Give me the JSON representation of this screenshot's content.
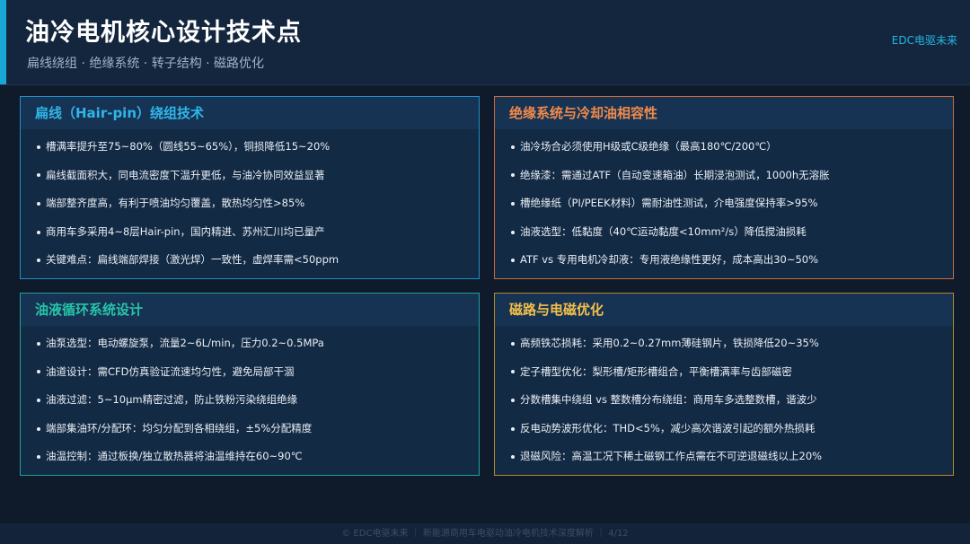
{
  "header": {
    "title": "油冷电机核心设计技术点",
    "subtitle": "扁线绕组 · 绝缘系统 · 转子结构 · 磁路优化",
    "brand": "EDC电驱未来"
  },
  "cards": [
    {
      "title": "扁线（Hair-pin）绕组技术",
      "items": [
        "槽满率提升至75~80%（圆线55~65%），铜损降低15~20%",
        "扁线截面积大，同电流密度下温升更低，与油冷协同效益显著",
        "端部整齐度高，有利于喷油均匀覆盖，散热均匀性>85%",
        "商用车多采用4~8层Hair-pin，国内精进、苏州汇川均已量产",
        "关键难点：扁线端部焊接（激光焊）一致性，虚焊率需<50ppm"
      ]
    },
    {
      "title": "绝缘系统与冷却油相容性",
      "items": [
        "油冷场合必须使用H级或C级绝缘（最高180℃/200℃）",
        "绝缘漆：需通过ATF（自动变速箱油）长期浸泡测试，1000h无溶胀",
        "槽绝缘纸（PI/PEEK材料）需耐油性测试，介电强度保持率>95%",
        "油液选型：低黏度（40℃运动黏度<10mm²/s）降低搅油损耗",
        "ATF vs 专用电机冷却液：专用液绝缘性更好，成本高出30~50%"
      ]
    },
    {
      "title": "油液循环系统设计",
      "items": [
        "油泵选型：电动螺旋泵，流量2~6L/min，压力0.2~0.5MPa",
        "油道设计：需CFD仿真验证流速均匀性，避免局部干涸",
        "油液过滤：5~10μm精密过滤，防止铁粉污染绕组绝缘",
        "端部集油环/分配环：均匀分配到各相绕组，±5%分配精度",
        "油温控制：通过板换/独立散热器将油温维持在60~90℃"
      ]
    },
    {
      "title": "磁路与电磁优化",
      "items": [
        "高频铁芯损耗：采用0.2~0.27mm薄硅钢片，铁损降低20~35%",
        "定子槽型优化：梨形槽/矩形槽组合，平衡槽满率与齿部磁密",
        "分数槽集中绕组 vs 整数槽分布绕组：商用车多选整数槽，谐波少",
        "反电动势波形优化：THD<5%，减少高次谐波引起的额外热损耗",
        "退磁风险：高温工况下稀土磁钢工作点需在不可逆退磁线以上20%"
      ]
    }
  ],
  "footer": {
    "text": "© EDC电驱未来 ｜ 新能源商用车电驱动油冷电机技术深度解析 ｜ 4/12"
  }
}
